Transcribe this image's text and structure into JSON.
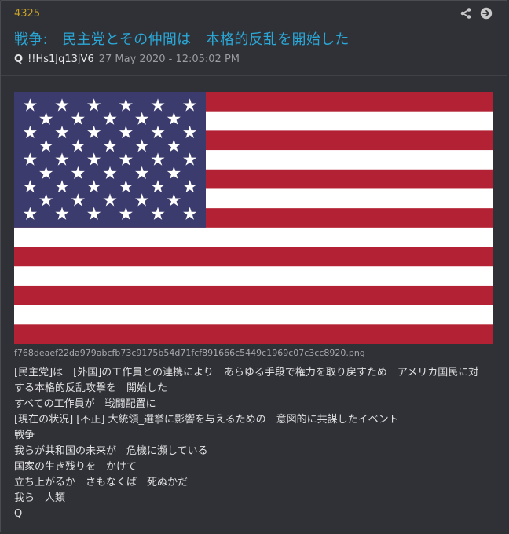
{
  "post": {
    "number": "4325",
    "title": "戦争:　民主党とその仲間は　本格的反乱を開始した",
    "author": "Q",
    "tripcode": "!!Hs1Jq13jV6",
    "date": "27 May 2020 - 12:05:02 PM"
  },
  "actions": {
    "share_icon": "share-icon",
    "open_icon": "arrow-right-circle-icon"
  },
  "image": {
    "filename": "f768deaef22da979abcfb73c9175b54d71fcf891666c5449c1969c07c3cc8920.png",
    "colors": {
      "red": "#b22234",
      "white": "#ffffff",
      "blue": "#3c3b6e"
    }
  },
  "body_lines": [
    "[民主党]は　[外国]の工作員との連携により　あらゆる手段で権力を取り戻すため　アメリカ国民に対",
    "する本格的反乱攻撃を　開始した",
    "すべての工作員が　戦闘配置に",
    "[現在の状況] [不正] 大統領_選挙に影響を与えるための　意図的に共謀したイベント",
    "戦争",
    "我らが共和国の未来が　危機に瀕している",
    "国家の生き残りを　かけて",
    "立ち上がるか　さもなくば　死ぬかだ",
    "我ら　人類",
    "Q"
  ]
}
